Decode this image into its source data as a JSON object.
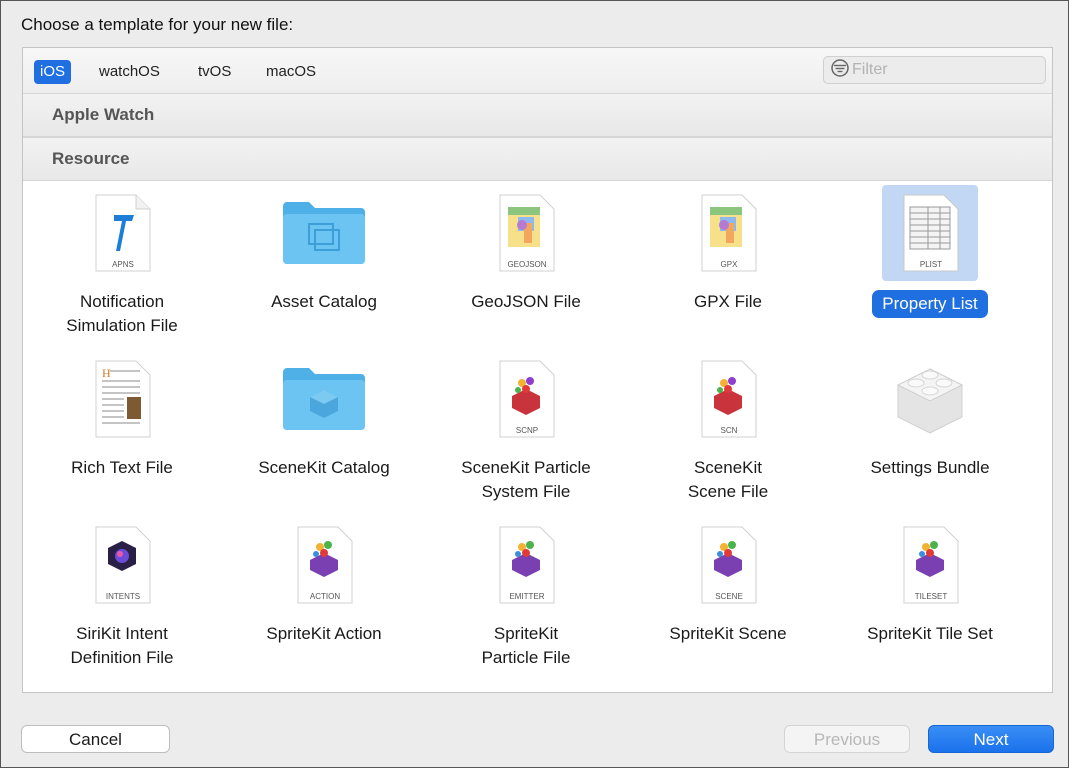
{
  "dialog": {
    "title": "Choose a template for your new file:"
  },
  "platform_tabs": [
    {
      "label": "iOS",
      "selected": true
    },
    {
      "label": "watchOS",
      "selected": false
    },
    {
      "label": "tvOS",
      "selected": false
    },
    {
      "label": "macOS",
      "selected": false
    }
  ],
  "filter": {
    "placeholder": "Filter",
    "value": ""
  },
  "sections": {
    "apple_watch": "Apple Watch",
    "resource": "Resource"
  },
  "templates": [
    {
      "label": "Notification\nSimulation File",
      "badge": "APNS",
      "icon": "apns-file-icon",
      "selected": false
    },
    {
      "label": "Asset Catalog",
      "badge": "",
      "icon": "asset-catalog-folder-icon",
      "selected": false
    },
    {
      "label": "GeoJSON File",
      "badge": "GEOJSON",
      "icon": "geojson-file-icon",
      "selected": false
    },
    {
      "label": "GPX File",
      "badge": "GPX",
      "icon": "gpx-file-icon",
      "selected": false
    },
    {
      "label": "Property List",
      "badge": "PLIST",
      "icon": "plist-file-icon",
      "selected": true
    },
    {
      "label": "Rich Text File",
      "badge": "",
      "icon": "rich-text-file-icon",
      "selected": false
    },
    {
      "label": "SceneKit Catalog",
      "badge": "",
      "icon": "scenekit-catalog-folder-icon",
      "selected": false
    },
    {
      "label": "SceneKit Particle\nSystem File",
      "badge": "SCNP",
      "icon": "scnp-file-icon",
      "selected": false
    },
    {
      "label": "SceneKit\nScene File",
      "badge": "SCN",
      "icon": "scn-file-icon",
      "selected": false
    },
    {
      "label": "Settings Bundle",
      "badge": "",
      "icon": "settings-bundle-icon",
      "selected": false
    },
    {
      "label": "SiriKit Intent\nDefinition File",
      "badge": "INTENTS",
      "icon": "intents-file-icon",
      "selected": false
    },
    {
      "label": "SpriteKit Action",
      "badge": "ACTION",
      "icon": "action-file-icon",
      "selected": false
    },
    {
      "label": "SpriteKit\nParticle File",
      "badge": "EMITTER",
      "icon": "emitter-file-icon",
      "selected": false
    },
    {
      "label": "SpriteKit Scene",
      "badge": "SCENE",
      "icon": "scene-file-icon",
      "selected": false
    },
    {
      "label": "SpriteKit Tile Set",
      "badge": "TILESET",
      "icon": "tileset-file-icon",
      "selected": false
    }
  ],
  "buttons": {
    "cancel": "Cancel",
    "previous": "Previous",
    "next": "Next"
  },
  "colors": {
    "accent": "#1f6fe0",
    "selection_bg": "#c2d7f4",
    "folder": "#5fb9ec"
  }
}
